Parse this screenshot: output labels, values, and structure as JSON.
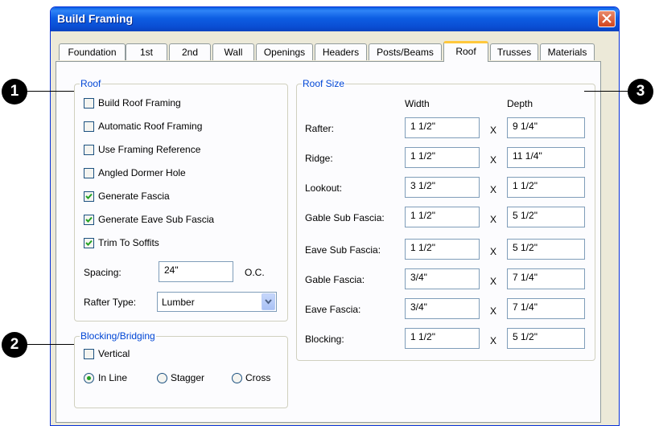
{
  "window": {
    "title": "Build Framing"
  },
  "tabs": [
    {
      "label": "Foundation",
      "active": false
    },
    {
      "label": "1st",
      "active": false
    },
    {
      "label": "2nd",
      "active": false
    },
    {
      "label": "Wall",
      "active": false
    },
    {
      "label": "Openings",
      "active": false
    },
    {
      "label": "Headers",
      "active": false
    },
    {
      "label": "Posts/Beams",
      "active": false
    },
    {
      "label": "Roof",
      "active": true
    },
    {
      "label": "Trusses",
      "active": false
    },
    {
      "label": "Materials",
      "active": false
    }
  ],
  "callouts": [
    "1",
    "2",
    "3"
  ],
  "roof": {
    "legend": "Roof",
    "checkboxes": [
      {
        "label": "Build Roof Framing",
        "checked": false
      },
      {
        "label": "Automatic Roof Framing",
        "checked": false
      },
      {
        "label": "Use Framing Reference",
        "checked": false
      },
      {
        "label": "Angled Dormer Hole",
        "checked": false
      },
      {
        "label": "Generate Fascia",
        "checked": true
      },
      {
        "label": "Generate Eave Sub Fascia",
        "checked": true
      },
      {
        "label": "Trim To Soffits",
        "checked": true
      }
    ],
    "spacing": {
      "label": "Spacing:",
      "value": "24\"",
      "unit": "O.C."
    },
    "rafter_type": {
      "label": "Rafter Type:",
      "value": "Lumber"
    }
  },
  "blocking": {
    "legend": "Blocking/Bridging",
    "vertical": {
      "label": "Vertical",
      "checked": false
    },
    "options": [
      {
        "label": "In Line",
        "selected": true
      },
      {
        "label": "Stagger",
        "selected": false
      },
      {
        "label": "Cross",
        "selected": false
      }
    ]
  },
  "roof_size": {
    "legend": "Roof Size",
    "width_header": "Width",
    "depth_header": "Depth",
    "separator": "X",
    "rows": [
      {
        "label": "Rafter:",
        "width": "1 1/2\"",
        "depth": "9 1/4\""
      },
      {
        "label": "Ridge:",
        "width": "1 1/2\"",
        "depth": "11 1/4\""
      },
      {
        "label": "Lookout:",
        "width": "3 1/2\"",
        "depth": "1 1/2\""
      },
      {
        "label": "Gable Sub Fascia:",
        "width": "1 1/2\"",
        "depth": "5 1/2\""
      },
      {
        "label": "Eave Sub Fascia:",
        "width": "1 1/2\"",
        "depth": "5 1/2\""
      },
      {
        "label": "Gable Fascia:",
        "width": "3/4\"",
        "depth": "7 1/4\""
      },
      {
        "label": "Eave Fascia:",
        "width": "3/4\"",
        "depth": "7 1/4\""
      },
      {
        "label": "Blocking:",
        "width": "1 1/2\"",
        "depth": "5 1/2\""
      }
    ]
  }
}
